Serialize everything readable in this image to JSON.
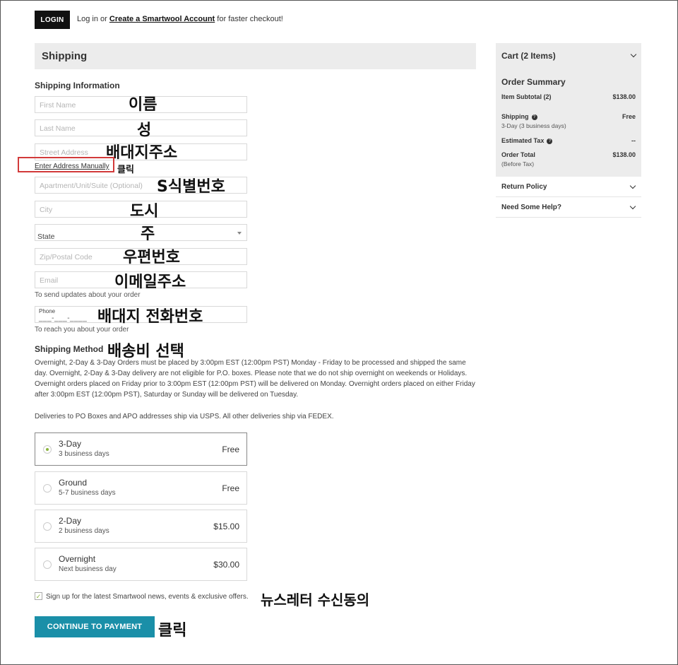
{
  "top": {
    "login_label": "LOGIN",
    "login_prefix": "Log in or",
    "create_account": "Create a Smartwool Account",
    "login_suffix": "for faster checkout!"
  },
  "shipping": {
    "header": "Shipping",
    "info_title": "Shipping Information",
    "first_name_ph": "First Name",
    "last_name_ph": "Last Name",
    "street_ph": "Street Address",
    "manual_link": "Enter Address Manually",
    "apt_ph": "Apartment/Unit/Suite (Optional)",
    "city_ph": "City",
    "state_value": "State",
    "zip_ph": "Zip/Postal Code",
    "email_ph": "Email",
    "email_note": "To send updates about your order",
    "phone_label": "Phone",
    "phone_mask": "___-___-____",
    "phone_note": "To reach you about your order"
  },
  "method": {
    "title": "Shipping Method",
    "para1": "Overnight, 2-Day & 3-Day Orders must be placed by 3:00pm EST (12:00pm PST) Monday - Friday to be processed and shipped the same day. Overnight, 2-Day & 3-Day delivery are not eligible for P.O. boxes. Please note that we do not ship overnight on weekends or Holidays. Overnight orders placed on Friday prior to 3:00pm EST (12:00pm PST) will be delivered on Monday. Overnight orders placed on either Friday after 3:00pm EST (12:00pm PST), Saturday or Sunday will be delivered on Tuesday.",
    "para2": "Deliveries to PO Boxes and APO addresses ship via USPS. All other deliveries ship via FEDEX.",
    "options": [
      {
        "name": "3-Day",
        "days": "3 business days",
        "price": "Free",
        "selected": true
      },
      {
        "name": "Ground",
        "days": "5-7 business days",
        "price": "Free",
        "selected": false
      },
      {
        "name": "2-Day",
        "days": "2 business days",
        "price": "$15.00",
        "selected": false
      },
      {
        "name": "Overnight",
        "days": "Next business day",
        "price": "$30.00",
        "selected": false
      }
    ]
  },
  "newsletter": {
    "label": "Sign up for the latest Smartwool news, events & exclusive offers.",
    "checked": true
  },
  "pay_button": "CONTINUE TO PAYMENT",
  "annotations": {
    "first_name": "이름",
    "last_name": "성",
    "street": "배대지주소",
    "click1": "클릭",
    "apt": "S식별번호",
    "city": "도시",
    "state": "주",
    "zip": "우편번호",
    "email": "이메일주소",
    "phone": "배대지 전화번호",
    "method": "배송비 선택",
    "newsletter": "뉴스레터 수신동의",
    "click2": "클릭"
  },
  "cart": {
    "header": "Cart (2 Items)",
    "summary_title": "Order Summary",
    "subtotal_label": "Item Subtotal (2)",
    "subtotal_value": "$138.00",
    "shipping_label": "Shipping",
    "shipping_sub": "3-Day (3 business days)",
    "shipping_value": "Free",
    "tax_label": "Estimated Tax",
    "tax_value": "--",
    "total_label": "Order Total",
    "total_sub": "(Before Tax)",
    "total_value": "$138.00",
    "return_policy": "Return Policy",
    "need_help": "Need Some Help?"
  },
  "colors": {
    "accent": "#1a8fa8",
    "annotation_box": "#d23a3a",
    "radio_on": "#8ab43c"
  }
}
